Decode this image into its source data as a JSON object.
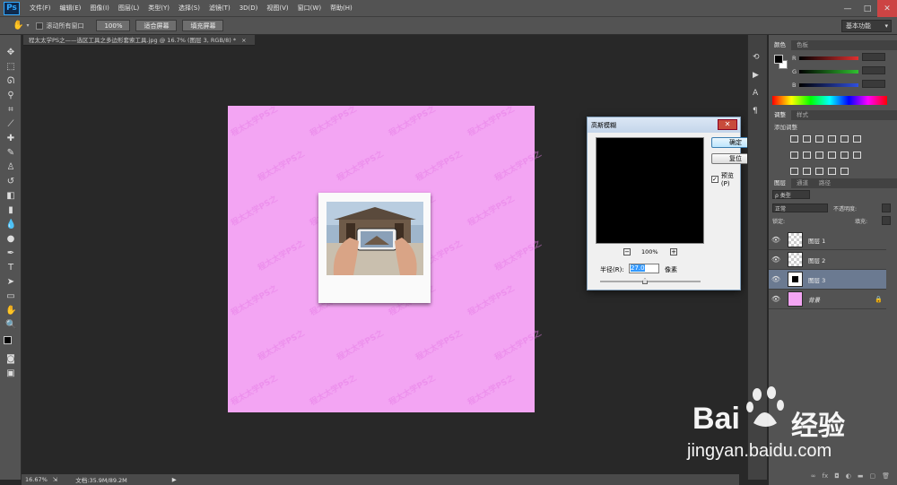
{
  "app": {
    "logo": "Ps"
  },
  "menu": [
    "文件(F)",
    "编辑(E)",
    "图像(I)",
    "图层(L)",
    "类型(Y)",
    "选择(S)",
    "滤镜(T)",
    "3D(D)",
    "视图(V)",
    "窗口(W)",
    "帮助(H)"
  ],
  "window_controls": {
    "minimize": "—",
    "maximize": "□",
    "close": "✕"
  },
  "options_bar": {
    "scroll_all_label": "滚动所有窗口",
    "btn_100": "100%",
    "btn_fit": "适合屏幕",
    "btn_fill": "填充屏幕",
    "workspace": "基本功能"
  },
  "document": {
    "tab_title": "程太太学PS之——选区工具之多边形套索工具.jpg @ 16.7% (图层 3, RGB/8) *",
    "tab_close": "×",
    "watermark_text": "程太太学PS之"
  },
  "status": {
    "zoom": "16.67%",
    "doc_size": "文档:35.9M/89.2M"
  },
  "gaussian_blur": {
    "title": "高斯模糊",
    "ok": "确定",
    "reset": "复位",
    "preview_label": "预览(P)",
    "preview_checked": true,
    "zoom_out": "−",
    "zoom_in": "+",
    "zoom_level": "100%",
    "radius_label": "半径(R):",
    "radius_value": "27.0",
    "radius_unit": "像素"
  },
  "panels": {
    "color_tabs": [
      "颜色",
      "色板"
    ],
    "channels": [
      "R",
      "G",
      "B"
    ],
    "channel_colors": [
      "#e03030",
      "#30c030",
      "#3050e0"
    ],
    "adjust_tabs": [
      "调整",
      "样式"
    ],
    "adjust_label": "添加调整",
    "layers_tabs": [
      "图层",
      "通道",
      "路径"
    ],
    "kind_label": "ρ 类型",
    "blend_mode": "正常",
    "opacity_label": "不透明度:",
    "lock_label": "锁定:",
    "fill_label": "填充:",
    "layers": [
      {
        "name": "图层 1",
        "selected": false,
        "thumb": "checker"
      },
      {
        "name": "图层 2",
        "selected": false,
        "thumb": "checker"
      },
      {
        "name": "图层 3",
        "selected": true,
        "thumb": "black-square"
      },
      {
        "name": "背景",
        "selected": false,
        "thumb": "#f3a5f3",
        "locked": true
      }
    ]
  },
  "watermark": {
    "brand": "Bai",
    "brand2": "经验",
    "url": "jingyan.baidu.com"
  },
  "colors": {
    "canvas": "#f3a5f3",
    "selected_layer": "#6b7a91",
    "ui_bg": "#535353"
  }
}
